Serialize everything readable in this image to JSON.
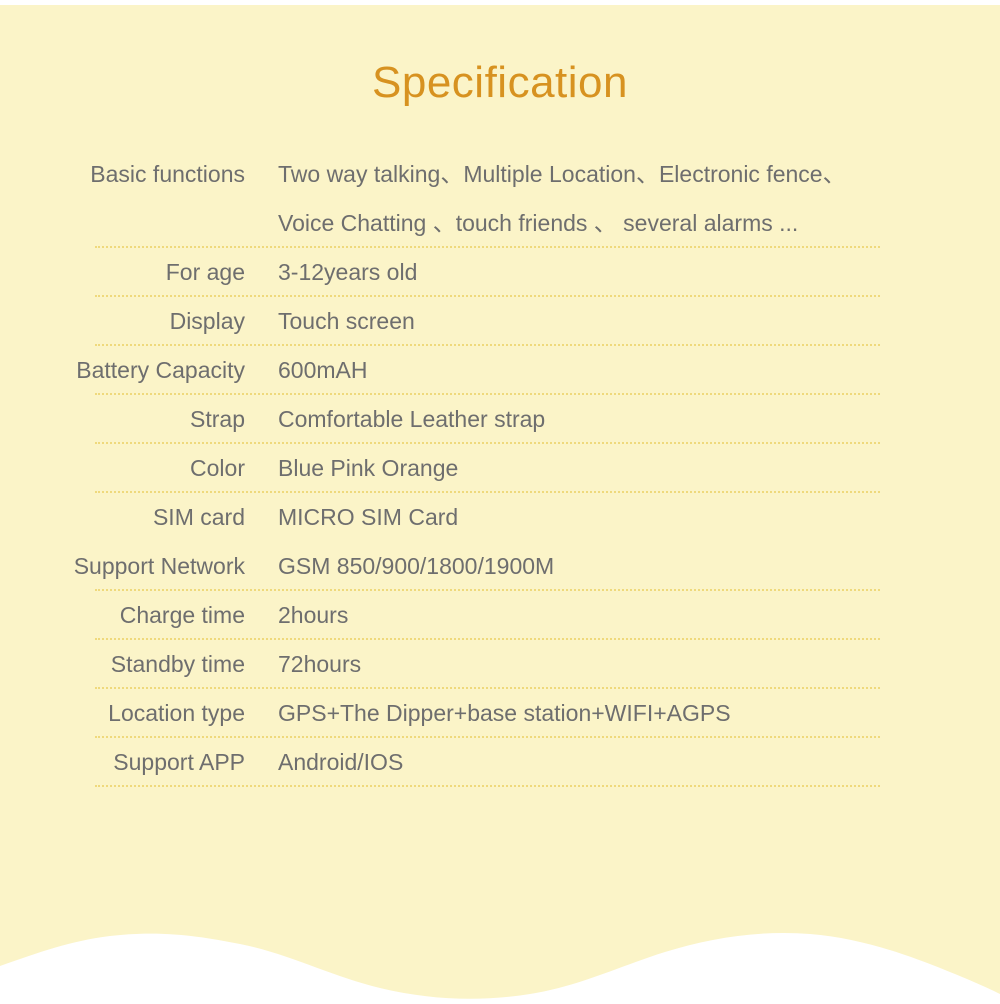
{
  "page": {
    "background_color": "#fbf4c8",
    "wave_color": "#ffffff"
  },
  "title": {
    "text": "Specification",
    "color": "#d79220"
  },
  "spec_table": {
    "label_color": "#6e6e6e",
    "value_color": "#6e6e6e",
    "separator_color": "#efd97c",
    "rows": [
      {
        "label": "Basic functions",
        "value": "Two way talking、Multiple Location、Electronic fence、\nVoice  Chatting 、touch friends 、 several alarms  ...",
        "separator": true
      },
      {
        "label": "For age",
        "value": "3-12years old",
        "separator": true
      },
      {
        "label": "Display",
        "value": "Touch screen",
        "separator": true
      },
      {
        "label": "Battery Capacity",
        "value": "600mAH",
        "separator": true
      },
      {
        "label": "Strap",
        "value": "Comfortable Leather strap",
        "separator": true
      },
      {
        "label": "Color",
        "value": "Blue Pink Orange",
        "separator": true
      },
      {
        "label": "SIM card",
        "value": "MICRO SIM Card",
        "separator": false
      },
      {
        "label": "Support Network",
        "value": "GSM 850/900/1800/1900M",
        "separator": true
      },
      {
        "label": "Charge time",
        "value": "2hours",
        "separator": true
      },
      {
        "label": "Standby time",
        "value": "72hours",
        "separator": true
      },
      {
        "label": "Location type",
        "value": "GPS+The Dipper+base station+WIFI+AGPS",
        "separator": true
      },
      {
        "label": "Support APP",
        "value": "Android/IOS",
        "separator": true
      }
    ]
  }
}
